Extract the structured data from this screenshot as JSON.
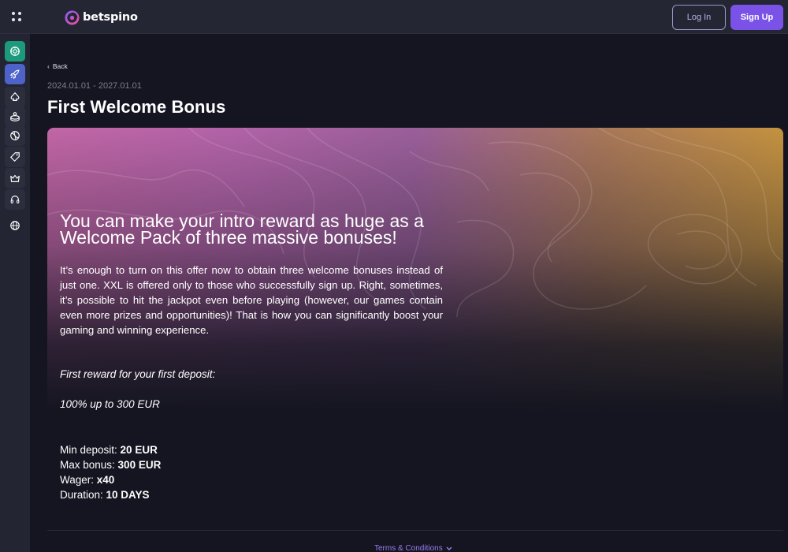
{
  "header": {
    "logo_text": "betspino",
    "login_label": "Log In",
    "signup_label": "Sign Up"
  },
  "sidebar": {
    "items": [
      {
        "icon": "casino-chip-icon",
        "state": "active-green"
      },
      {
        "icon": "rocket-icon",
        "state": "active-blue"
      },
      {
        "icon": "spade-icon",
        "state": "plain"
      },
      {
        "icon": "live-casino-icon",
        "state": "plain"
      },
      {
        "icon": "sports-ball-icon",
        "state": "plain"
      },
      {
        "icon": "tag-icon",
        "state": "plain"
      },
      {
        "icon": "crown-icon",
        "state": "plain"
      },
      {
        "icon": "headset-icon",
        "state": "plain"
      },
      {
        "icon": "globe-icon",
        "state": "none"
      }
    ]
  },
  "main": {
    "back_label": "Back",
    "date_range": "2024.01.01 - 2027.01.01",
    "title": "First Welcome Bonus",
    "banner": {
      "headline": "You can make your intro reward as huge as a Welcome Pack of three massive bonuses!",
      "description": "It’s enough to turn on this offer now to obtain three welcome bonuses instead of just one. XXL is offered only to those who successfully sign up. Right, sometimes, it’s possible to hit the jackpot even before playing (however, our games contain even more prizes and opportunities)! That is how you can significantly boost your gaming and winning experience.",
      "reward_heading": "First reward for your first deposit:",
      "reward_value": "100% up to 300 EUR",
      "details": [
        {
          "label": "Min deposit: ",
          "value": "20 EUR"
        },
        {
          "label": "Max bonus: ",
          "value": "300 EUR"
        },
        {
          "label": "Wager: ",
          "value": "x40"
        },
        {
          "label": "Duration: ",
          "value": "10 DAYS"
        }
      ]
    },
    "terms_label": "Terms & Conditions"
  },
  "colors": {
    "accent": "#7a52e7",
    "background": "#141520",
    "header": "#242634"
  }
}
